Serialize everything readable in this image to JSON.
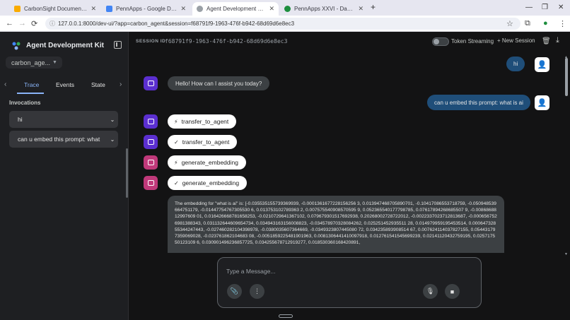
{
  "browser": {
    "tabs": [
      {
        "label": "CarbonSight Documentation",
        "favicon_color": "#f9ab00"
      },
      {
        "label": "PennApps - Google Docs",
        "favicon_color": "#4285f4"
      },
      {
        "label": "Agent Development Kit Dev UI",
        "favicon_color": "#9aa0a6"
      },
      {
        "label": "PennApps XXVI - Day of Events",
        "favicon_color": "#1e8e3e"
      }
    ],
    "url": "127.0.0.1:8000/dev-ui/?app=carbon_agent&session=f68791f9-1963-476f-b942-68d69d6e8ec3"
  },
  "sidebar": {
    "title": "Agent Development Kit",
    "agent": "carbon_age...",
    "tabs": [
      "Trace",
      "Events",
      "State"
    ],
    "invocations_title": "Invocations",
    "invocations": [
      "hi",
      "can u embed this prompt: what"
    ]
  },
  "header": {
    "session_label": "SESSION ID",
    "session_id": "f68791f9-1963-476f-b942-68d69d6e8ec3",
    "token_streaming": "Token Streaming",
    "new_session": "New Session"
  },
  "chat": {
    "user_hi": "hi",
    "bot_greeting": "Hello! How can I assist you today?",
    "user_prompt": "can u embed this prompt: what is ai",
    "fn_calls": [
      {
        "icon": "⚡",
        "name": "transfer_to_agent"
      },
      {
        "icon": "✓",
        "name": "transfer_to_agent"
      },
      {
        "icon": "⚡",
        "name": "generate_embedding"
      },
      {
        "icon": "✓",
        "name": "generate_embedding"
      }
    ],
    "embedding": "The embedding for \"what is ai\" is: [-0.035535155739369939, -0.0001361677228156256 3, 0.013947468705890701, -0.10417086553718759, -0.050948539664751179, -0.01447754767305530 6, 0.013753102789363 2, 0.007575540908570595 9, 0.052365540177798785, 0.07617894268685507 9, -0.0086868812997609 01, 0.016426668781658253, -0.0210729641367102, 0.079679301517692938, 0.20268002728722012, -0.0022337023712813687, -0.0006567526981388343, 0.031132644609654734, 0.034943163156008823, -0.034578970328084262, 0.025251452935511 28, 0.014979959195453514, 0.00064732855344247443, -0.027460282104398978, -0.0380035607364669, -0.0349323807445080 72, 0.034235893908514 67, 0.007624114037827155, 0.054431797359069028, -0.023761862104683 08, -0.0051859225481901963, 0.0081306441410097918, 0.012761541545699239, 0.02141120432759195, 0.025717550123109 6, 0.030901496236857725, 0.034255678712919277, 0.018530360168420891,"
  },
  "composer": {
    "placeholder": "Type a Message..."
  }
}
